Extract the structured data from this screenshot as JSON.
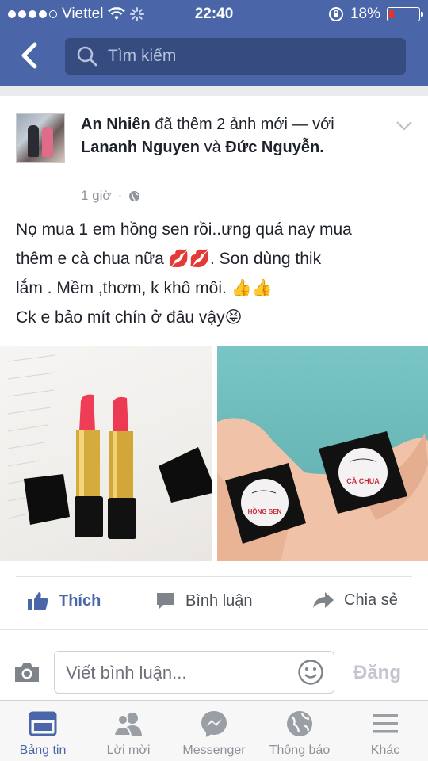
{
  "status_bar": {
    "carrier": "Viettel",
    "time": "22:40",
    "battery_percent": "18%",
    "battery_level": 0.18
  },
  "nav": {
    "search_placeholder": "Tìm kiếm"
  },
  "post": {
    "author": "An Nhiên",
    "action_text": "đã thêm 2 ảnh mới —",
    "with_text": "với",
    "tagged1": "Lananh Nguyen",
    "and_text": "và",
    "tagged2": "Đức Nguyễn.",
    "time": "1 giờ",
    "body_line1": "Nọ mua 1 em hồng sen rồi..ưng quá nay mua",
    "body_line2": "thêm e cà chua nữa 💋💋. Son dùng thik",
    "body_line3": "lắm . Mềm ,thơm, k khô môi. 👍👍",
    "body_line4": "Ck e bảo mít chín ở đâu vậy😝",
    "photo2_label_left": "HỒNG SEN",
    "photo2_label_right": "CÀ CHUA"
  },
  "actions": {
    "like": "Thích",
    "comment": "Bình luận",
    "share": "Chia sẻ"
  },
  "comment_box": {
    "placeholder": "Viết bình luận...",
    "post_button": "Đăng"
  },
  "tabs": [
    {
      "label": "Bảng tin",
      "icon": "news-feed-icon"
    },
    {
      "label": "Lời mời",
      "icon": "friend-requests-icon"
    },
    {
      "label": "Messenger",
      "icon": "messenger-icon"
    },
    {
      "label": "Thông báo",
      "icon": "globe-icon"
    },
    {
      "label": "Khác",
      "icon": "menu-icon"
    }
  ],
  "colors": {
    "brand": "#4a66a8",
    "search_bg": "#364c80",
    "battery_low": "#e8322e",
    "action_icon": "#4a66a8"
  }
}
